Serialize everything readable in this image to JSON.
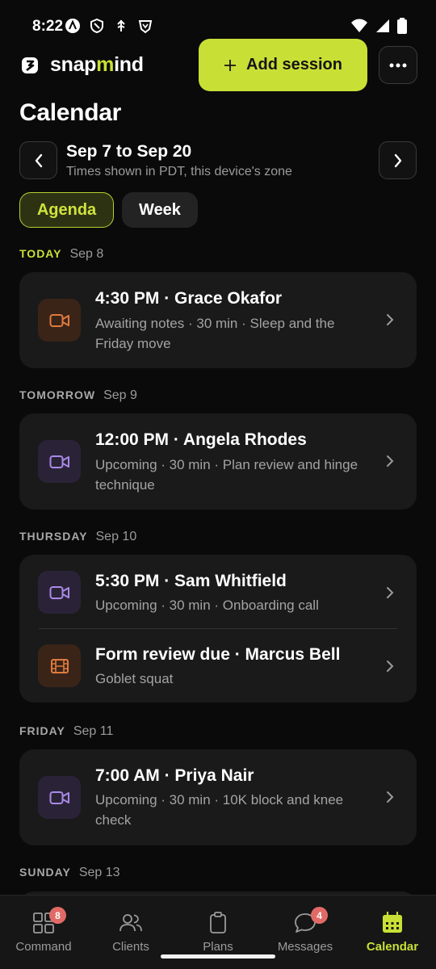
{
  "status_bar": {
    "time": "8:22"
  },
  "header": {
    "brand_prefix": "snap",
    "brand_accent": "m",
    "brand_suffix": "ind",
    "add_label": "Add session"
  },
  "page": {
    "title": "Calendar",
    "range_title": "Sep 7 to Sep 20",
    "range_sub": "Times shown in PDT, this device's zone"
  },
  "view_toggle": {
    "agenda": "Agenda",
    "week": "Week",
    "selected": "Agenda"
  },
  "days": [
    {
      "name": "TODAY",
      "date": "Sep 8",
      "items": [
        {
          "icon": "video-icon",
          "color": "#e07a3e",
          "title": "4:30 PM · Grace Okafor",
          "sub": "Awaiting notes · 30 min · Sleep and the Friday move"
        }
      ]
    },
    {
      "name": "TOMORROW",
      "date": "Sep 9",
      "items": [
        {
          "icon": "video-icon",
          "color": "#a98ae6",
          "title": "12:00 PM · Angela Rhodes",
          "sub": "Upcoming · 30 min · Plan review and hinge technique"
        }
      ]
    },
    {
      "name": "THURSDAY",
      "date": "Sep 10",
      "items": [
        {
          "icon": "video-icon",
          "color": "#a98ae6",
          "title": "5:30 PM · Sam Whitfield",
          "sub": "Upcoming · 30 min · Onboarding call"
        },
        {
          "icon": "film-icon",
          "color": "#e07a3e",
          "title": "Form review due · Marcus Bell",
          "sub": "Goblet squat"
        }
      ]
    },
    {
      "name": "FRIDAY",
      "date": "Sep 11",
      "items": [
        {
          "icon": "video-icon",
          "color": "#a98ae6",
          "title": "7:00 AM · Priya Nair",
          "sub": "Upcoming · 30 min · 10K block and knee check"
        }
      ]
    },
    {
      "name": "SUNDAY",
      "date": "Sep 13",
      "items": []
    }
  ],
  "bottom_nav": [
    {
      "label": "Command",
      "icon": "grid-icon",
      "badge": "8"
    },
    {
      "label": "Clients",
      "icon": "users-icon",
      "badge": ""
    },
    {
      "label": "Plans",
      "icon": "clipboard-icon",
      "badge": ""
    },
    {
      "label": "Messages",
      "icon": "chat-icon",
      "badge": "4"
    },
    {
      "label": "Calendar",
      "icon": "calendar-icon",
      "badge": "",
      "active": true
    }
  ],
  "colors": {
    "accent": "#c8e036",
    "background": "#0a0a0a",
    "card": "#1a1a1a",
    "badge": "#e26a66"
  }
}
